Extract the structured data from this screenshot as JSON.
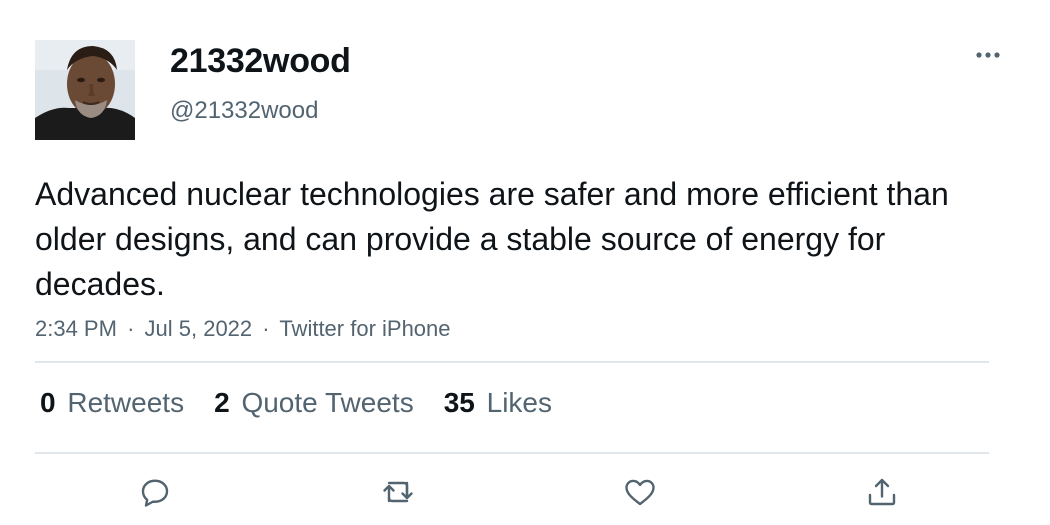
{
  "user": {
    "display_name": "21332wood",
    "handle": "@21332wood"
  },
  "tweet": {
    "text": "Advanced nuclear technologies are safer and more efficient than older designs, and can provide a stable source of energy for decades.",
    "time": "2:34 PM",
    "separator": "·",
    "date": "Jul 5, 2022",
    "source": "Twitter for iPhone"
  },
  "stats": {
    "retweets": {
      "count": "0",
      "label": "Retweets"
    },
    "quote_tweets": {
      "count": "2",
      "label": "Quote Tweets"
    },
    "likes": {
      "count": "35",
      "label": "Likes"
    }
  },
  "icons": {
    "more": "more-horizontal-icon",
    "reply": "reply-icon",
    "retweet": "retweet-icon",
    "like": "heart-icon",
    "share": "share-icon"
  },
  "colors": {
    "text_primary": "#0f1419",
    "text_secondary": "#536471",
    "divider": "#e1e6ea"
  }
}
